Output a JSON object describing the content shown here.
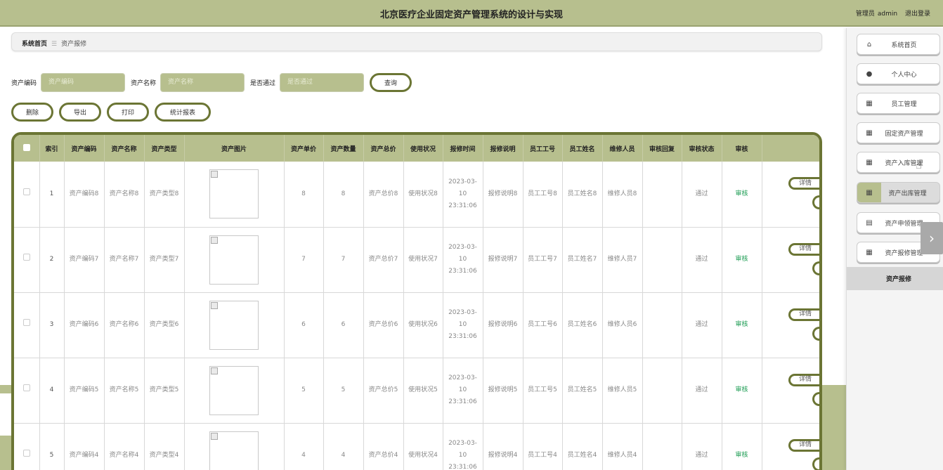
{
  "header": {
    "title": "北京医疗企业固定资产管理系统的设计与实现",
    "role": "管理员",
    "username": "admin",
    "logout": "退出登录"
  },
  "breadcrumb": {
    "home": "系统首页",
    "separator": "☰",
    "current": "资产报修"
  },
  "search": {
    "fields": [
      {
        "label": "资产编码",
        "placeholder": "资产编码"
      },
      {
        "label": "资产名称",
        "placeholder": "资产名称"
      },
      {
        "label": "是否通过",
        "placeholder": "是否通过"
      }
    ],
    "query_label": "查询"
  },
  "actions": {
    "delete": "删除",
    "export": "导出",
    "print": "打印",
    "report": "统计报表"
  },
  "table": {
    "headers": [
      "索引",
      "资产编码",
      "资产名称",
      "资产类型",
      "资产图片",
      "资产单价",
      "资产数量",
      "资产总价",
      "使用状况",
      "报修时间",
      "报修说明",
      "员工工号",
      "员工姓名",
      "维修人员",
      "审核回复",
      "审核状态",
      "审核",
      ""
    ],
    "rows": [
      {
        "index": "1",
        "code": "资产编码8",
        "name": "资产名称8",
        "type": "资产类型8",
        "price": "8",
        "qty": "8",
        "total": "资产总价8",
        "usage": "使用状况8",
        "time": "2023-03-10 23:31:06",
        "desc": "报修说明8",
        "emp_no": "员工工号8",
        "emp_name": "员工姓名8",
        "repairer": "维修人员8",
        "reply": "",
        "status": "通过",
        "audit": "审核",
        "detail": "详情"
      },
      {
        "index": "2",
        "code": "资产编码7",
        "name": "资产名称7",
        "type": "资产类型7",
        "price": "7",
        "qty": "7",
        "total": "资产总价7",
        "usage": "使用状况7",
        "time": "2023-03-10 23:31:06",
        "desc": "报修说明7",
        "emp_no": "员工工号7",
        "emp_name": "员工姓名7",
        "repairer": "维修人员7",
        "reply": "",
        "status": "通过",
        "audit": "审核",
        "detail": "详情"
      },
      {
        "index": "3",
        "code": "资产编码6",
        "name": "资产名称6",
        "type": "资产类型6",
        "price": "6",
        "qty": "6",
        "total": "资产总价6",
        "usage": "使用状况6",
        "time": "2023-03-10 23:31:06",
        "desc": "报修说明6",
        "emp_no": "员工工号6",
        "emp_name": "员工姓名6",
        "repairer": "维修人员6",
        "reply": "",
        "status": "通过",
        "audit": "审核",
        "detail": "详情"
      },
      {
        "index": "4",
        "code": "资产编码5",
        "name": "资产名称5",
        "type": "资产类型5",
        "price": "5",
        "qty": "5",
        "total": "资产总价5",
        "usage": "使用状况5",
        "time": "2023-03-10 23:31:06",
        "desc": "报修说明5",
        "emp_no": "员工工号5",
        "emp_name": "员工姓名5",
        "repairer": "维修人员5",
        "reply": "",
        "status": "通过",
        "audit": "审核",
        "detail": "详情"
      },
      {
        "index": "5",
        "code": "资产编码4",
        "name": "资产名称4",
        "type": "资产类型4",
        "price": "4",
        "qty": "4",
        "total": "资产总价4",
        "usage": "使用状况4",
        "time": "2023-03-10 23:31:06",
        "desc": "报修说明4",
        "emp_no": "员工工号4",
        "emp_name": "员工姓名4",
        "repairer": "维修人员4",
        "reply": "",
        "status": "通过",
        "audit": "审核",
        "detail": "详情"
      }
    ]
  },
  "sidebar": {
    "items": [
      {
        "label": "系统首页",
        "icon": "home-icon"
      },
      {
        "label": "个人中心",
        "icon": "user-icon"
      },
      {
        "label": "员工管理",
        "icon": "grid-icon"
      },
      {
        "label": "固定资产管理",
        "icon": "grid-icon"
      },
      {
        "label": "资产入库管理",
        "icon": "grid-icon"
      },
      {
        "label": "资产出库管理",
        "icon": "grid-icon"
      },
      {
        "label": "资产申领管理",
        "icon": "document-icon"
      },
      {
        "label": "资产报修管理",
        "icon": "grid-icon"
      }
    ],
    "sub_item": "资产报修"
  },
  "colors": {
    "accent": "#b7bf8e",
    "border_accent": "#6b7534",
    "audit_link": "#1f9d55"
  }
}
